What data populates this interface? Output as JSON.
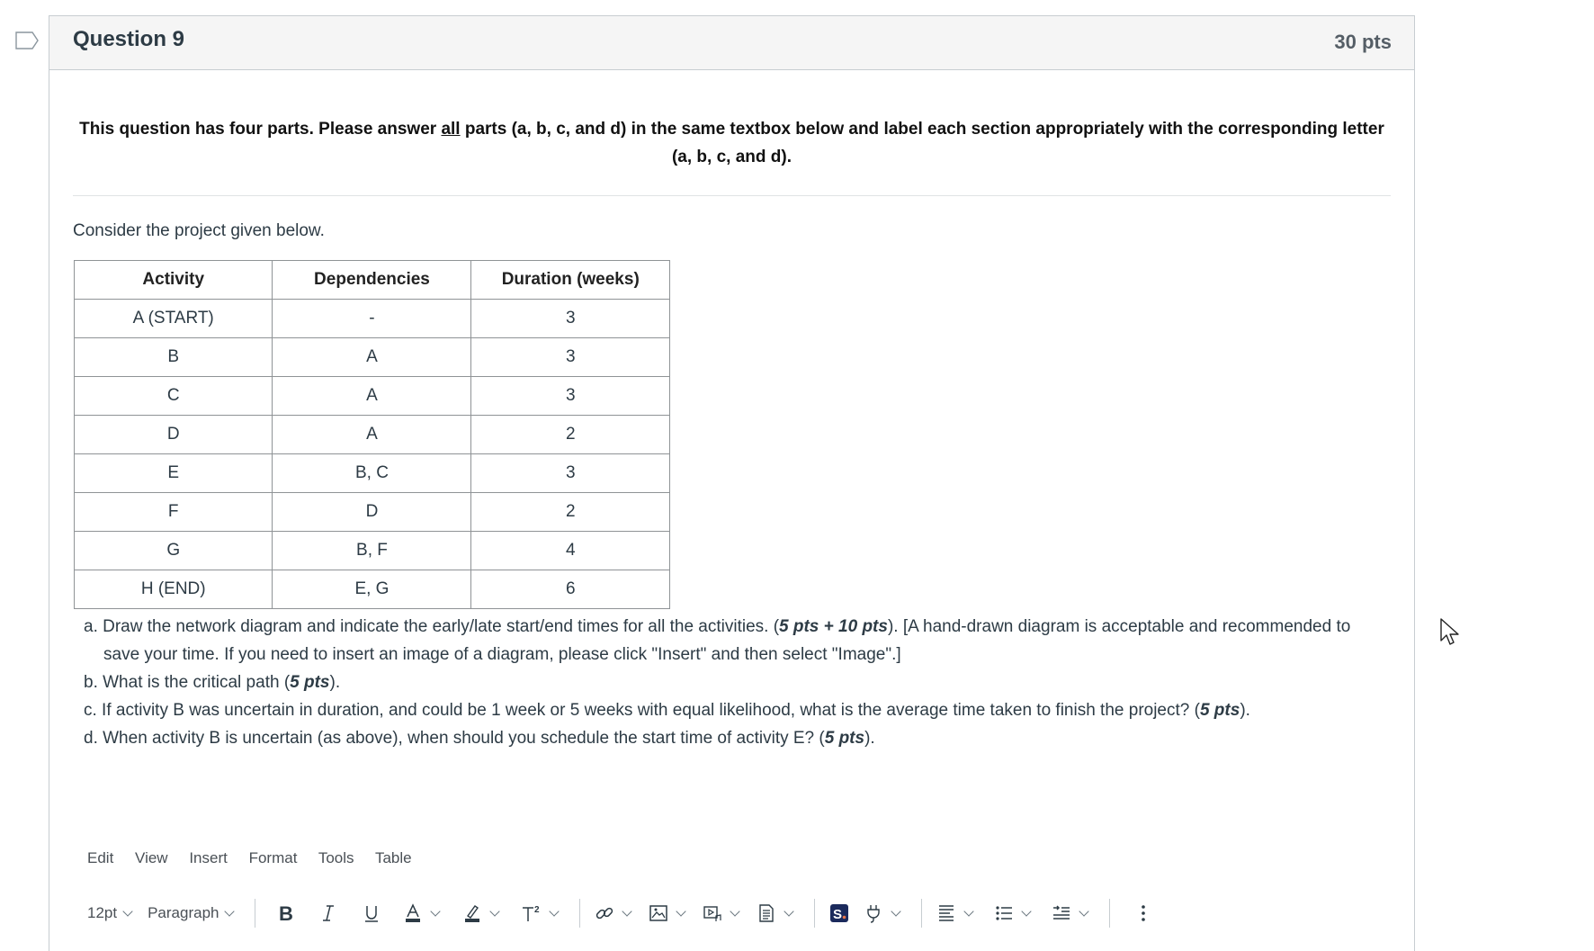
{
  "question": {
    "title": "Question 9",
    "points": "30 pts",
    "intro_prefix": "This question has four parts. Please answer ",
    "intro_underlined": "all",
    "intro_suffix": " parts (a, b, c, and d) in the same textbox below and label each section appropriately with the corresponding letter (a, b, c, and d).",
    "consider": "Consider the project given below."
  },
  "table": {
    "headers": [
      "Activity",
      "Dependencies",
      "Duration (weeks)"
    ],
    "rows": [
      [
        "A (START)",
        "-",
        "3"
      ],
      [
        "B",
        "A",
        "3"
      ],
      [
        "C",
        "A",
        "3"
      ],
      [
        "D",
        "A",
        "2"
      ],
      [
        "E",
        "B, C",
        "3"
      ],
      [
        "F",
        "D",
        "2"
      ],
      [
        "G",
        "B, F",
        "4"
      ],
      [
        "H (END)",
        "E, G",
        "6"
      ]
    ]
  },
  "parts": [
    {
      "pre": "a. Draw the network diagram and indicate the early/late start/end times for all the activities. (",
      "pts": "5 pts + 10 pts",
      "post": "). [A hand-drawn diagram is acceptable and recommended to save your time. If you need to insert an image of a diagram, please click \"Insert\" and then select \"Image\".]"
    },
    {
      "pre": "b. What is the critical path (",
      "pts": "5 pts",
      "post": ")."
    },
    {
      "pre": "c. If activity B was uncertain in duration, and could be 1 week or 5 weeks with equal likelihood, what is the average time taken to finish the project? (",
      "pts": "5 pts",
      "post": ")."
    },
    {
      "pre": "d. When activity B is uncertain (as above), when should you schedule the start time of activity E? (",
      "pts": "5 pts",
      "post": ")."
    }
  ],
  "editor": {
    "menu": [
      "Edit",
      "View",
      "Insert",
      "Format",
      "Tools",
      "Table"
    ],
    "font_size": "12pt",
    "block_format": "Paragraph",
    "icons": [
      "bold-icon",
      "italic-icon",
      "underline-icon",
      "text-color-icon",
      "highlight-icon",
      "superscript-icon",
      "link-icon",
      "image-icon",
      "media-icon",
      "document-icon",
      "s-app-icon",
      "plugin-icon",
      "align-icon",
      "bullet-list-icon",
      "indent-icon",
      "more-icon"
    ],
    "s_app_label": "S.",
    "s_app_color": "#1b2a5c"
  }
}
